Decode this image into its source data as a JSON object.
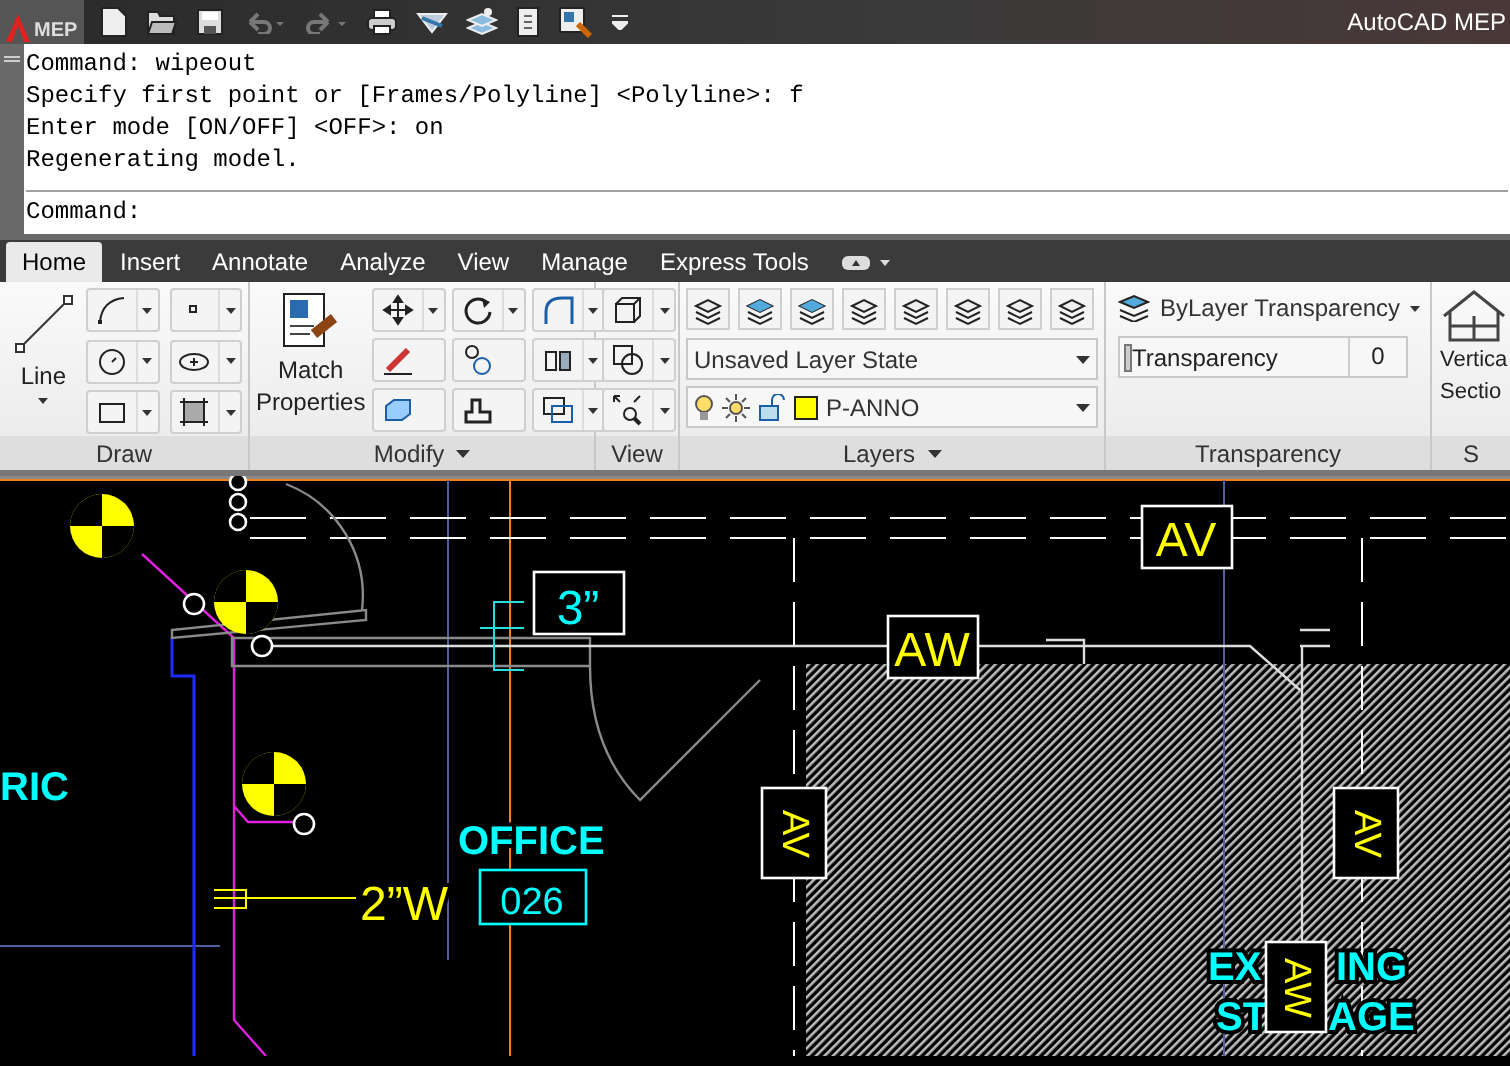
{
  "title_bar": {
    "app_badge": "MEP",
    "title": "AutoCAD MEP"
  },
  "command_line": {
    "history": [
      "Command: wipeout",
      "Specify first point or [Frames/Polyline] <Polyline>: f",
      "Enter mode [ON/OFF] <OFF>: on",
      "Regenerating model."
    ],
    "prompt": "Command:"
  },
  "ribbon_tabs": [
    {
      "label": "Home",
      "selected": true
    },
    {
      "label": "Insert",
      "selected": false
    },
    {
      "label": "Annotate",
      "selected": false
    },
    {
      "label": "Analyze",
      "selected": false
    },
    {
      "label": "View",
      "selected": false
    },
    {
      "label": "Manage",
      "selected": false
    },
    {
      "label": "Express Tools",
      "selected": false
    }
  ],
  "ribbon_panels": [
    {
      "title": "Draw",
      "has_menu": false
    },
    {
      "title": "Modify",
      "has_menu": true
    },
    {
      "title": "View",
      "has_menu": false
    },
    {
      "title": "Layers",
      "has_menu": true
    },
    {
      "title": "Transparency",
      "has_menu": false
    },
    {
      "title": "S",
      "has_menu": false
    }
  ],
  "draw_panel": {
    "line_button": "Line"
  },
  "modify_panel": {
    "match_properties": "Match Properties"
  },
  "layers_panel": {
    "layer_state": "Unsaved Layer State",
    "current_layer": {
      "name": "P-ANNO",
      "color": "#ffff00"
    }
  },
  "transparency_panel": {
    "mode": "ByLayer Transparency",
    "field_label": "Transparency",
    "value": "0",
    "level": 0
  },
  "section_panel": {
    "label_lines": [
      "Vertica",
      "Sectio"
    ]
  },
  "drawing": {
    "labels": [
      {
        "kind": "room",
        "text": "RIC"
      },
      {
        "kind": "room",
        "text": "OFFICE"
      },
      {
        "kind": "room_number",
        "text": "026"
      },
      {
        "kind": "size",
        "text": "2”W"
      },
      {
        "kind": "dimension",
        "text": "3”"
      },
      {
        "kind": "tag",
        "text": "AV"
      },
      {
        "kind": "tag",
        "text": "AW"
      },
      {
        "kind": "tag_vertical",
        "text": "AV"
      },
      {
        "kind": "tag_vertical",
        "text": "AV"
      },
      {
        "kind": "room",
        "text": "EX"
      },
      {
        "kind": "room",
        "text": "ING"
      },
      {
        "kind": "room",
        "text": "ST"
      },
      {
        "kind": "room",
        "text": "AGE"
      },
      {
        "kind": "tag_vertical",
        "text": "AW"
      }
    ]
  }
}
